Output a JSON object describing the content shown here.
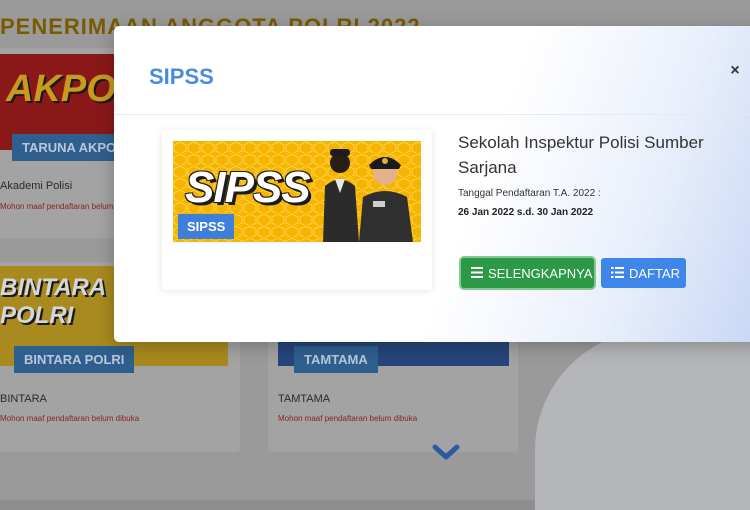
{
  "background": {
    "heading": "PENERIMAAN ANGGOTA POLRI 2022",
    "cards": [
      {
        "banner": "AKPOL",
        "tag": "TARUNA AKPOL",
        "title": "Akademi Polisi",
        "note": "Mohon maaf pendaftaran belum dibuka"
      },
      {
        "banner": "BINTARA POLRI",
        "tag": "BINTARA POLRI",
        "title": "BINTARA",
        "note": "Mohon maaf pendaftaran belum dibuka"
      },
      {
        "banner": "",
        "tag": "TAMTAMA",
        "title": "TAMTAMA",
        "note": "Mohon maaf pendaftaran belum dibuka"
      }
    ]
  },
  "modal": {
    "title": "SIPSS",
    "close_label": "×",
    "poster": {
      "word": "SIPSS",
      "tag": "SIPSS"
    },
    "program_title": "Sekolah Inspektur Polisi Sumber Sarjana",
    "registration_label": "Tanggal Pendaftaran T.A. 2022 :",
    "registration_dates": "26 Jan 2022 s.d. 30 Jan 2022",
    "buttons": {
      "details_label": "SELENGKAPNYA",
      "register_label": "DAFTAR"
    }
  },
  "colors": {
    "accent_blue": "#3f86ea",
    "title_blue": "#4a8be0",
    "button_green": "#2c9a45",
    "poster_yellow": "#f5b400"
  },
  "icons": [
    "hamburger-menu-icon",
    "list-icon",
    "close-icon",
    "chevron-down-icon"
  ]
}
